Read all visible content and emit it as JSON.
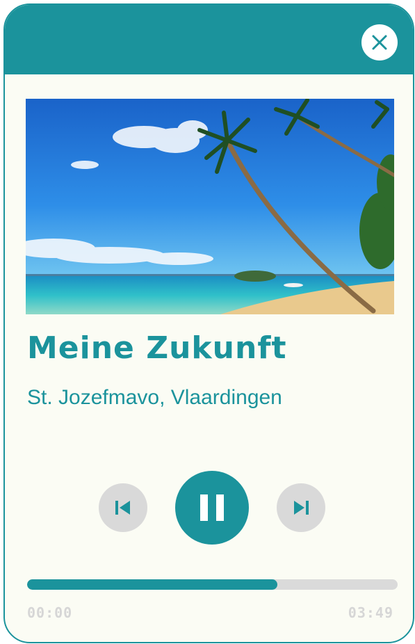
{
  "player": {
    "track_title": "Meine Zukunft",
    "artist": "St. Jozefmavo, Vlaardingen",
    "elapsed": "00:00",
    "duration": "03:49",
    "progress": 0.675,
    "state": "playing"
  },
  "icons": {
    "close": "close-icon",
    "previous": "skip-previous-icon",
    "pause": "pause-icon",
    "next": "skip-next-icon"
  },
  "colors": {
    "accent": "#1b939c",
    "background": "#fbfcf4",
    "secondary_button": "#d9d9d9",
    "track": "#dadada"
  }
}
